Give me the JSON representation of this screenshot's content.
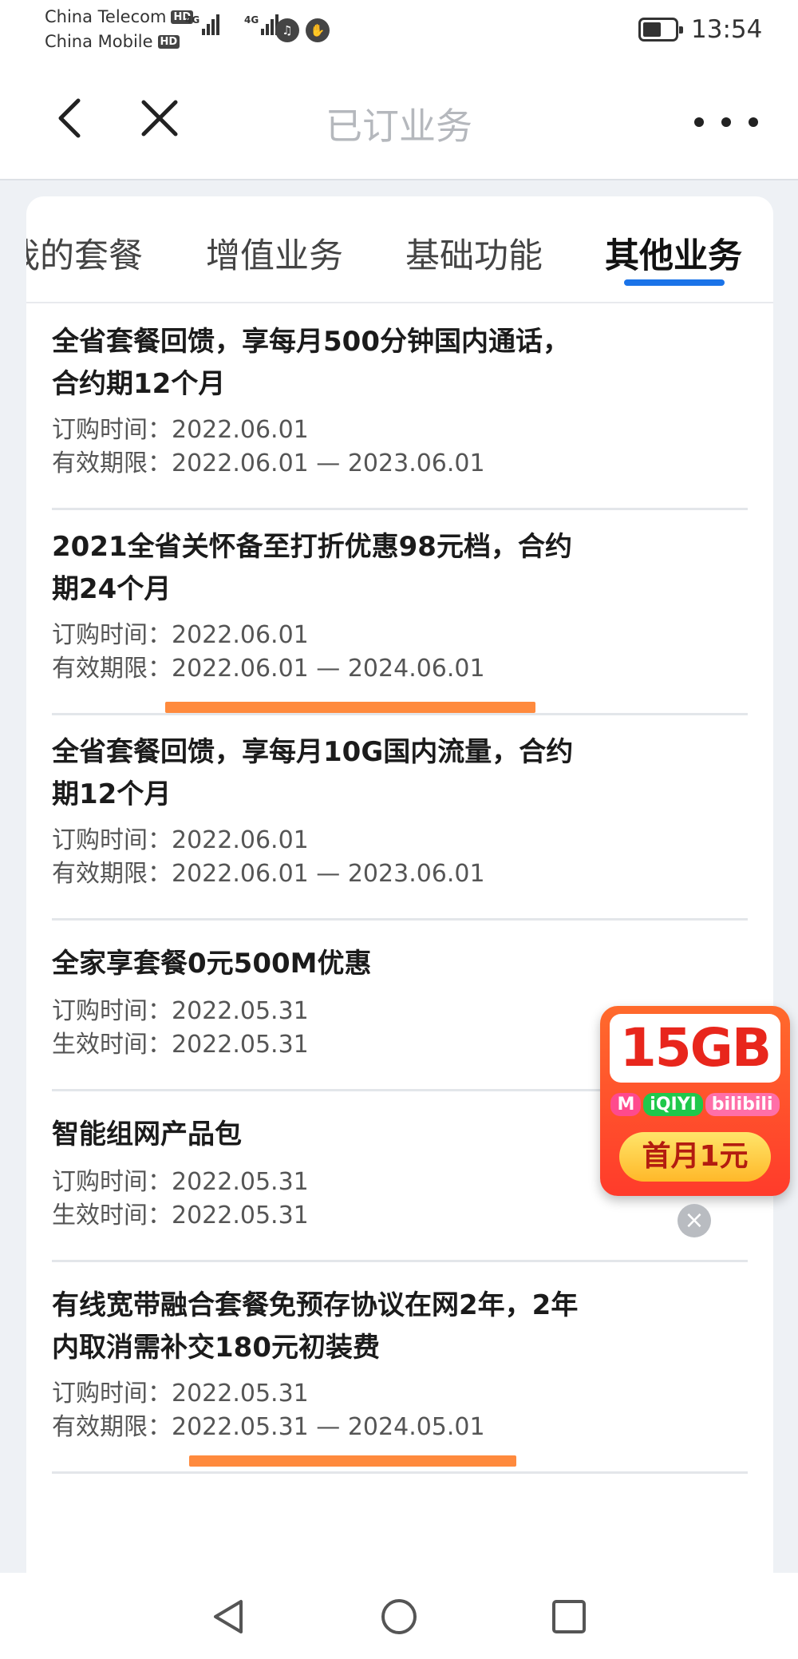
{
  "status_bar": {
    "carrier_1": "China Telecom",
    "carrier_2": "China Mobile",
    "hd_badge": "HD",
    "network_tag": "4G",
    "time": "13:54"
  },
  "nav": {
    "title": "已订业务",
    "back_icon": "chevron-left-icon",
    "close_icon": "close-icon",
    "more_icon": "more-horizontal-icon"
  },
  "tabs": [
    {
      "label": "我的套餐",
      "active": false
    },
    {
      "label": "增值业务",
      "active": false
    },
    {
      "label": "基础功能",
      "active": false
    },
    {
      "label": "其他业务",
      "active": true
    }
  ],
  "labels": {
    "order_time": "订购时间：",
    "valid_period": "有效期限：",
    "effective_time": "生效时间："
  },
  "items": [
    {
      "title": "全省套餐回馈，享每月500分钟国内通话，合约期12个月",
      "order_time": "2022.06.01",
      "second_label": "有效期限：",
      "second_value": "2022.06.01 — 2023.06.01",
      "highlighted": false
    },
    {
      "title": "2021全省关怀备至打折优惠98元档，合约期24个月",
      "order_time": "2022.06.01",
      "second_label": "有效期限：",
      "second_value": "2022.06.01 — 2024.06.01",
      "highlighted": true
    },
    {
      "title": "全省套餐回馈，享每月10G国内流量，合约期12个月",
      "order_time": "2022.06.01",
      "second_label": "有效期限：",
      "second_value": "2022.06.01 — 2023.06.01",
      "highlighted": false
    },
    {
      "title": "全家享套餐0元500M优惠",
      "order_time": "2022.05.31",
      "second_label": "生效时间：",
      "second_value": "2022.05.31",
      "highlighted": false
    },
    {
      "title": "智能组网产品包",
      "order_time": "2022.05.31",
      "second_label": "生效时间：",
      "second_value": "2022.05.31",
      "highlighted": false
    },
    {
      "title": "有线宽带融合套餐免预存协议在网2年，2年内取消需补交180元初装费",
      "order_time": "2022.05.31",
      "second_label": "有效期限：",
      "second_value": "2022.05.31 — 2024.05.01",
      "highlighted": true
    }
  ],
  "ad": {
    "headline": "15GB",
    "logos": [
      "M",
      "iQIYI",
      "bilibili"
    ],
    "cta": "首月1元",
    "close_icon": "close-icon"
  },
  "system_nav": {
    "back_icon": "triangle-back-icon",
    "home_icon": "circle-home-icon",
    "recents_icon": "square-recents-icon"
  },
  "colors": {
    "accent": "#1a73e8",
    "highlight_mark": "#ff8a3d",
    "ad_red": "#ff3b2b"
  }
}
